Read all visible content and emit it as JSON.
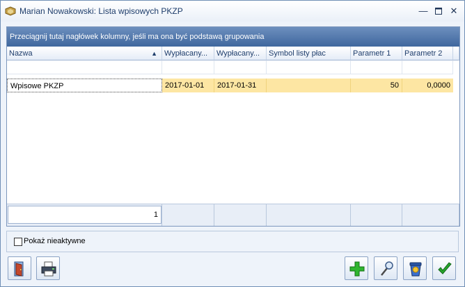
{
  "window": {
    "title": "Marian Nowakowski: Lista wpisowych PKZP"
  },
  "grid": {
    "group_hint": "Przeciągnij tutaj nagłówek kolumny, jeśli ma ona być podstawą grupowania",
    "columns": [
      "Nazwa",
      "Wypłacany...",
      "Wypłacany...",
      "Symbol listy płac",
      "Parametr 1",
      "Parametr 2"
    ],
    "rows": [
      {
        "nazwa": "Wpisowe PKZP",
        "od": "2017-01-01",
        "do": "2017-01-31",
        "symbol": "",
        "param1": "50",
        "param2": "0,0000"
      }
    ],
    "record_count": "1"
  },
  "options": {
    "show_inactive_label": "Pokaż nieaktywne",
    "show_inactive_checked": false
  },
  "colors": {
    "accent": "#3f679e",
    "selection": "#fde6a3"
  }
}
